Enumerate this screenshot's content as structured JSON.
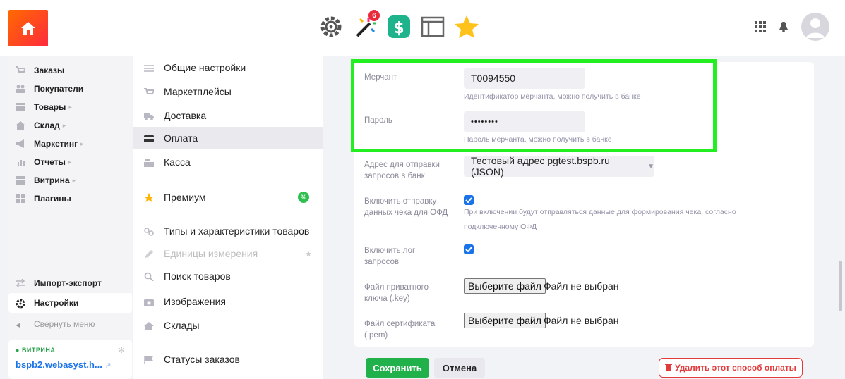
{
  "topbar": {
    "apps": [
      {
        "name": "settings-gear-app-icon"
      },
      {
        "name": "wand-app-icon",
        "badge": "6"
      },
      {
        "name": "money-app-icon"
      },
      {
        "name": "window-app-icon"
      },
      {
        "name": "star-app-icon"
      }
    ]
  },
  "sidebar": {
    "items": [
      {
        "label": "Заказы",
        "icon": "cart-icon",
        "arrow": ""
      },
      {
        "label": "Покупатели",
        "icon": "users-icon",
        "arrow": ""
      },
      {
        "label": "Товары",
        "icon": "products-icon",
        "arrow": "▸"
      },
      {
        "label": "Склад",
        "icon": "warehouse-icon",
        "arrow": "▸"
      },
      {
        "label": "Маркетинг",
        "icon": "megaphone-icon",
        "arrow": "▸"
      },
      {
        "label": "Отчеты",
        "icon": "chart-icon",
        "arrow": "▸"
      },
      {
        "label": "Витрина",
        "icon": "storefront-icon",
        "arrow": "▸"
      },
      {
        "label": "Плагины",
        "icon": "plugins-icon",
        "arrow": ""
      }
    ],
    "import_export": "Импорт-экспорт",
    "settings": "Настройки",
    "collapse": "Свернуть меню",
    "storefront_label": "ВИТРИНА",
    "storefront_url": "bspb2.webasyst.h..."
  },
  "settings_menu": {
    "items": [
      {
        "label": "Общие настройки"
      },
      {
        "label": "Маркетплейсы"
      },
      {
        "label": "Доставка"
      },
      {
        "label": "Оплата"
      },
      {
        "label": "Касса"
      },
      {
        "label": "Премиум"
      },
      {
        "label": "Типы и характеристики товаров"
      },
      {
        "label": "Единицы измерения"
      },
      {
        "label": "Поиск товаров"
      },
      {
        "label": "Изображения"
      },
      {
        "label": "Склады"
      },
      {
        "label": "Статусы заказов"
      }
    ],
    "premium_badge": "%"
  },
  "form": {
    "merchant_label": "Мерчант",
    "merchant_value": "T0094550",
    "merchant_hint": "Идентификатор мерчанта, можно получить в банке",
    "password_label": "Пароль",
    "password_value": "••••••••",
    "password_hint": "Пароль мерчанта, можно получить в банке",
    "bank_address_label_1": "Адрес для отправки",
    "bank_address_label_2": "запросов в банк",
    "bank_address_value": "Тестовый адрес pgtest.bspb.ru (JSON)",
    "ofd_label_1": "Включить отправку",
    "ofd_label_2": "данных чека для ОФД",
    "ofd_hint_1": "При включении будут отправляться данные для формирования чека, согласно",
    "ofd_hint_2": "подключенному ОФД",
    "ofd_checked": true,
    "log_label_1": "Включить лог",
    "log_label_2": "запросов",
    "log_checked": true,
    "key_label_1": "Файл приватного",
    "key_label_2": "ключа (.key)",
    "cert_label_1": "Файл сертификата",
    "cert_label_2": "(.pem)",
    "file_button": "Выберите файл",
    "file_status": "Файл не выбран"
  },
  "actions": {
    "save": "Сохранить",
    "cancel": "Отмена",
    "delete": "Удалить этот способ оплаты"
  }
}
